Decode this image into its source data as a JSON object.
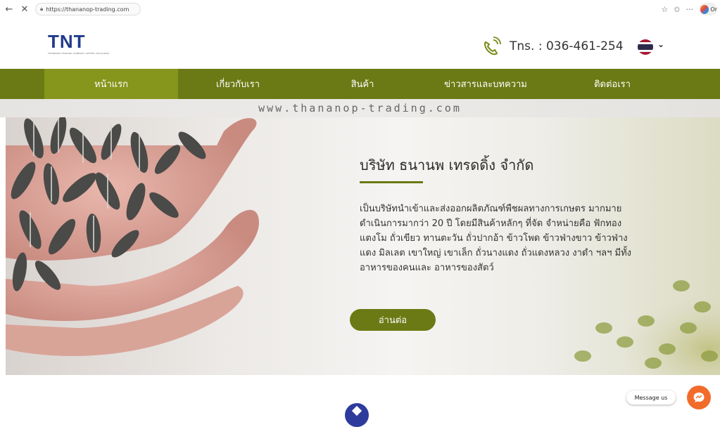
{
  "browser": {
    "back_icon": "arrow-left-icon",
    "close_icon": "close-icon",
    "url": "https://thananop-trading.com",
    "profile_label": "Or"
  },
  "header": {
    "logo": "TNT",
    "logo_subtitle": "THANANOP TRADING COMPANY LIMITED (THAILAND)",
    "phone": "Tns. : 036-461-254"
  },
  "nav": {
    "items": [
      {
        "label": "หน้าแรก"
      },
      {
        "label": "เกี่ยวกับเรา"
      },
      {
        "label": "สินค้า"
      },
      {
        "label": "ข่าวสารและบทความ"
      },
      {
        "label": "ติดต่อเรา"
      }
    ]
  },
  "watermark": "www.thananop-trading.com",
  "hero": {
    "title": "บริษัท ธนานพ เทรดดิ้ง จำกัด",
    "description": "เป็นบริษัทนำเข้าและส่งออกผลิตภัณฑ์พืชผลทางการเกษตร มากมาย ดำเนินการมากว่า 20 ปี โดยมีสินค้าหลักๆ ที่จัด จำหน่ายคือ ฟักทอง แตงโม ถั่วเขียว ทานตะวัน ถั่วปากอ้า ข้าวโพด ข้าวฟ่างขาว ข้าวฟ่างแดง มิลเลต เขาใหญ่ เขาเล็ก ถั่วนางแดง ถั่วแดงหลวง งาดำ ฯลฯ มีทั้งอาหารของคนและ อาหารของสัตว์",
    "read_more": "อ่านต่อ"
  },
  "messenger": {
    "label": "Message us"
  },
  "colors": {
    "nav_green": "#6b7a14",
    "nav_active": "#86951c",
    "logo_blue": "#213b8c",
    "messenger_orange": "#f26b2b"
  }
}
